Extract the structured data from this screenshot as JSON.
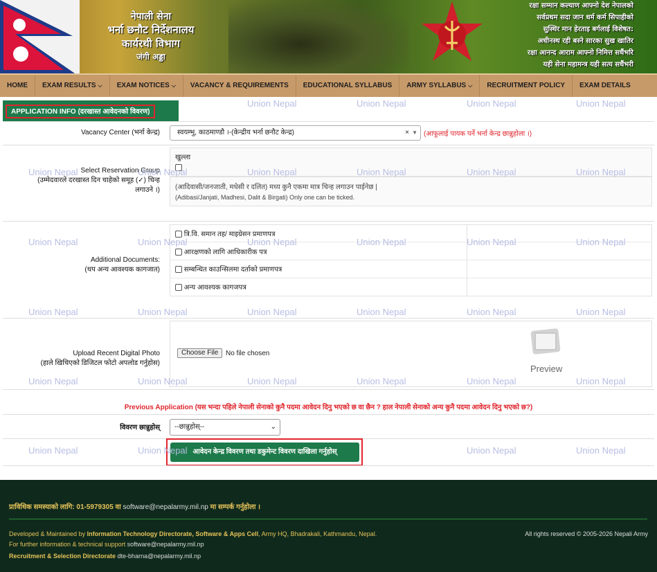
{
  "header": {
    "org_line1": "नेपाली सेना",
    "org_line2": "भर्ना छनौट निर्देशनालय",
    "org_line3": "कार्यरथी विभाग",
    "org_line4": "जंगी अड्डा",
    "motto": [
      "रक्षा सम्मान कल्याण आफ्नो देश नेपालको",
      "सर्वप्रथम सदा जान धर्म कर्म सिपाहीको",
      "सुस्थिर मान हेरताइ बर्गलाई विशेषत:",
      "अधीनस्थ रही बस्ने सारका सुख खातिर",
      "रक्षा आनन्द आराम आफ्नो निमित्त सधैंभरि",
      "यही सेना महामन्त्र यही सत्य सधैंभरी"
    ]
  },
  "nav": {
    "items": [
      {
        "label": "HOME"
      },
      {
        "label": "EXAM RESULTS",
        "chevron": "⌵"
      },
      {
        "label": "EXAM NOTICES",
        "chevron": "⌵"
      },
      {
        "label": "VACANCY & REQUIREMENTS"
      },
      {
        "label": "EDUCATIONAL SYLLABUS"
      },
      {
        "label": "ARMY SYLLABUS",
        "chevron": "⌵"
      },
      {
        "label": "RECRUITMENT POLICY"
      },
      {
        "label": "EXAM DETAILS"
      }
    ]
  },
  "section_title": "APPLICATION INFO (दरखास्त आवेदनको विवरण)",
  "vacancy": {
    "label": "Vacancy Center (भर्ना केन्द्र)",
    "value": "स्वयम्भु, काठमाण्डौ ।-(केन्द्रीय भर्ना छनौट केन्द्र)",
    "clear": "×",
    "note": "(आफूलाई पायक पर्ने भर्ना केन्द्र छान्नुहोला ।)"
  },
  "reservation": {
    "label1": "Select Reservation Group",
    "label2": "(उम्मेदवारले दरखास्त दिन चाहेको समूह (✓) चिन्ह",
    "label3": "लगाउने ।)",
    "option": "खुल्ला",
    "note_np": "(आदिवासी/जनजाती, मधेसी र दलित) मध्य कुनै एकमा मात्र चिन्ह लगाउन पाईनेछ |",
    "note_en": "(Adibasi/Janjati, Madhesi, Dalit & Birgati) Only one can be ticked."
  },
  "documents": {
    "label1": "Additional Documents:",
    "label2": "(थप अन्य आवश्यक कागजात)",
    "items": [
      "त्रि.वि. समान तह/ माइग्रेसन प्रमाणपत्र",
      "आरक्षणको लागि आधिकारीक पत्र",
      "सम्बन्धित काउन्सिलमा दर्ताको प्रमाणपत्र",
      "अन्य आवश्यक कागजपत्र"
    ]
  },
  "photo": {
    "label1": "Upload Recent Digital Photo",
    "label2": "(हाले खिचिएको डिजिटल फोटो अपलोड गर्नुहोस)",
    "choose": "Choose File",
    "status": "No file chosen",
    "preview": "Preview"
  },
  "previous_application": "Previous Application (यस भन्दा पहिले नेपाली सेनाको कुनै पदमा आवेदन दिनु भएको छ वा छैन ? हाल नेपाली सेनाको अन्य कुनै पदमा आवेदन दिनु भएको छ?)",
  "detail": {
    "label": "विवरण छान्नुहोस्",
    "value": "--छान्नुहोस्--"
  },
  "submit": "आवेदन केन्द्र विवरण तथा डकुमेन्ट विवरण दाखिला गर्नुहोस्",
  "watermark": "Union Nepal",
  "footer": {
    "contact_prefix": "प्राविधिक समस्याको लागि: 01-5979305 वा ",
    "contact_mail": "software@nepalarmy.mil.np",
    "contact_suffix": " मा सम्पर्क गर्नुहोला ।",
    "dev_prefix": "Developed & Maintained by ",
    "dev_bold": "Information Technology Directorate, Software & Apps Cell",
    "dev_suffix": ", Army HQ, Bhadrakali, Kathmandu, Nepal.",
    "rights": "All rights reserved © 2005-2026 Nepali Army",
    "support_prefix": "For further information & technical support ",
    "support_mail": "software@nepalarmy.mil.np",
    "recruit_prefix": "Recruitment & Selection Directorate ",
    "recruit_mail": "dte-bharna@nepalarmy.mil.np"
  },
  "colors": {
    "primary_green": "#1d7a4a",
    "nav_tan": "#c79a6a",
    "accent_red": "#e0242c",
    "footer_bg": "#0f2a1c",
    "footer_gold": "#e6c25a",
    "watermark": "#b7bde3"
  }
}
